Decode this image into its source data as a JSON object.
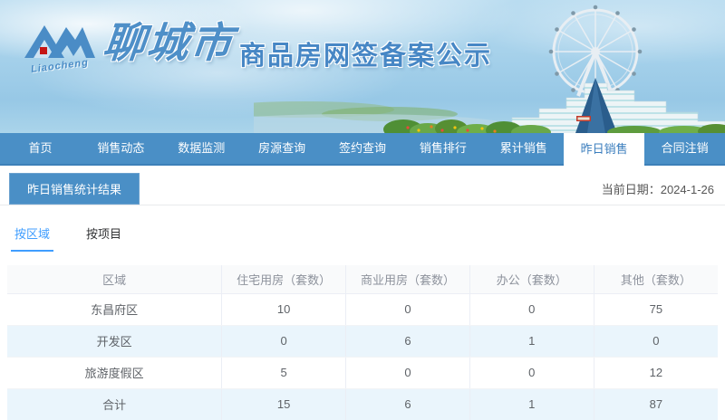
{
  "banner": {
    "logo_script": "Liaocheng",
    "logo_city": "聊城市",
    "title": "商品房网签备案公示"
  },
  "nav": {
    "items": [
      {
        "name": "home",
        "label": "首页",
        "active": false
      },
      {
        "name": "sales-dynamics",
        "label": "销售动态",
        "active": false
      },
      {
        "name": "data-monitor",
        "label": "数据监测",
        "active": false
      },
      {
        "name": "listing-query",
        "label": "房源查询",
        "active": false
      },
      {
        "name": "contract-query",
        "label": "签约查询",
        "active": false
      },
      {
        "name": "sales-ranking",
        "label": "销售排行",
        "active": false
      },
      {
        "name": "cumulative-sales",
        "label": "累计销售",
        "active": false
      },
      {
        "name": "yesterday-sales",
        "label": "昨日销售",
        "active": true
      },
      {
        "name": "contract-cancel",
        "label": "合同注销",
        "active": false
      }
    ]
  },
  "content": {
    "section_title": "昨日销售统计结果",
    "date_label": "当前日期：",
    "date_value": "2024-1-26",
    "tabs": [
      {
        "name": "by-region",
        "label": "按区域",
        "active": true
      },
      {
        "name": "by-project",
        "label": "按项目",
        "active": false
      }
    ]
  },
  "table": {
    "columns": [
      "区域",
      "住宅用房（套数）",
      "商业用房（套数）",
      "办公（套数）",
      "其他（套数）"
    ],
    "rows": [
      [
        "东昌府区",
        "10",
        "0",
        "0",
        "75"
      ],
      [
        "开发区",
        "0",
        "6",
        "1",
        "0"
      ],
      [
        "旅游度假区",
        "5",
        "0",
        "0",
        "12"
      ],
      [
        "合计",
        "15",
        "6",
        "1",
        "87"
      ]
    ]
  },
  "colors": {
    "nav_blue": "#4a8fc6",
    "accent_blue": "#409eff",
    "stripe_blue": "#eaf5fc"
  }
}
